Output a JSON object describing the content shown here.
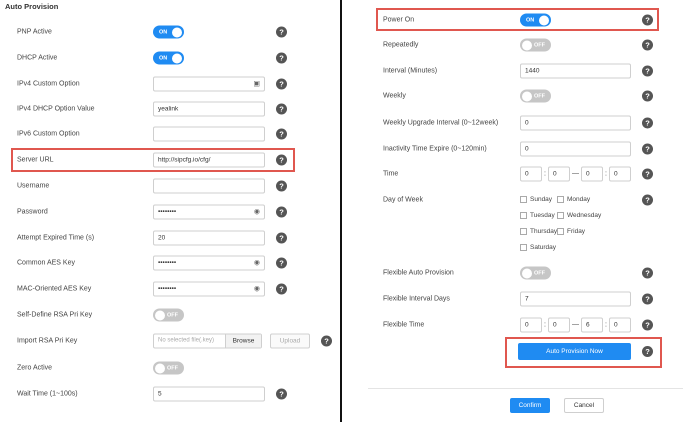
{
  "left": {
    "section_title": "Auto Provision",
    "pnp_active": {
      "label": "PNP Active",
      "toggle": "ON"
    },
    "dhcp_active": {
      "label": "DHCP Active",
      "toggle": "ON"
    },
    "ipv4_custom_option": {
      "label": "IPv4 Custom Option",
      "value": ""
    },
    "ipv4_dhcp_option_value": {
      "label": "IPv4 DHCP Option Value",
      "value": "yealink"
    },
    "ipv6_custom_option": {
      "label": "IPv6 Custom Option",
      "value": ""
    },
    "server_url": {
      "label": "Server URL",
      "value": "http://sipcfg.io/cfg/"
    },
    "username": {
      "label": "Username",
      "value": ""
    },
    "password": {
      "label": "Password",
      "value": "••••••••"
    },
    "attempt_expired_time": {
      "label": "Attempt Expired Time (s)",
      "value": "20"
    },
    "common_aes_key": {
      "label": "Common AES Key",
      "value": "••••••••"
    },
    "mac_oriented_aes_key": {
      "label": "MAC-Oriented AES Key",
      "value": "••••••••"
    },
    "self_define_rsa": {
      "label": "Self-Define RSA Pri Key",
      "toggle": "OFF"
    },
    "import_rsa": {
      "label": "Import RSA Pri Key",
      "file_placeholder": "No selected file(.key)",
      "browse_label": "Browse",
      "upload_label": "Upload"
    },
    "zero_active": {
      "label": "Zero Active",
      "toggle": "OFF"
    },
    "wait_time": {
      "label": "Wait Time (1~100s)",
      "value": "5"
    }
  },
  "right": {
    "power_on": {
      "label": "Power On",
      "toggle": "ON"
    },
    "repeatedly": {
      "label": "Repeatedly",
      "toggle": "OFF"
    },
    "interval": {
      "label": "Interval (Minutes)",
      "value": "1440"
    },
    "weekly": {
      "label": "Weekly",
      "toggle": "OFF"
    },
    "weekly_upgrade_interval": {
      "label": "Weekly Upgrade Interval (0~12week)",
      "value": "0"
    },
    "inactivity_time_expire": {
      "label": "Inactivity Time Expire (0~120min)",
      "value": "0"
    },
    "time": {
      "label": "Time",
      "start_h": "0",
      "start_m": "0",
      "end_h": "0",
      "end_m": "0",
      "sep": ":",
      "dash": "—"
    },
    "day_of_week": {
      "label": "Day of Week",
      "days": [
        "Sunday",
        "Monday",
        "Tuesday",
        "Wednesday",
        "Thursday",
        "Friday",
        "Saturday"
      ]
    },
    "flexible_auto_provision": {
      "label": "Flexible Auto Provision",
      "toggle": "OFF"
    },
    "flexible_interval_days": {
      "label": "Flexible Interval Days",
      "value": "7"
    },
    "flexible_time": {
      "label": "Flexible Time",
      "start_h": "0",
      "start_m": "0",
      "end_h": "6",
      "end_m": "0"
    },
    "auto_provision_now_label": "Auto Provision Now",
    "confirm_label": "Confirm",
    "cancel_label": "Cancel"
  },
  "help_glyph": "?",
  "colors": {
    "accent": "#1f8bf2",
    "highlight": "#e0574f",
    "toggle_off": "#c6c6c6"
  }
}
